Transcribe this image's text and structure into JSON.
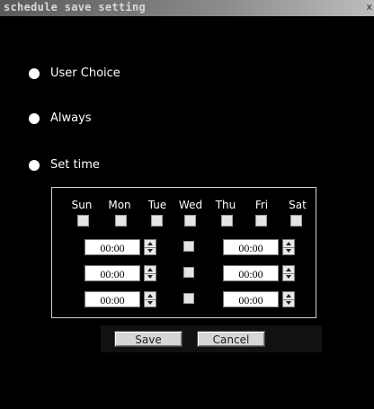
{
  "window": {
    "title": "schedule save setting",
    "close_label": "x"
  },
  "options": [
    {
      "label": "User Choice"
    },
    {
      "label": "Always"
    },
    {
      "label": "Set time"
    }
  ],
  "days": [
    "Sun",
    "Mon",
    "Tue",
    "Wed",
    "Thu",
    "Fri",
    "Sat"
  ],
  "time_rows": [
    {
      "start": "00:00",
      "end": "00:00"
    },
    {
      "start": "00:00",
      "end": "00:00"
    },
    {
      "start": "00:00",
      "end": "00:00"
    }
  ],
  "buttons": {
    "save": "Save",
    "cancel": "Cancel"
  }
}
